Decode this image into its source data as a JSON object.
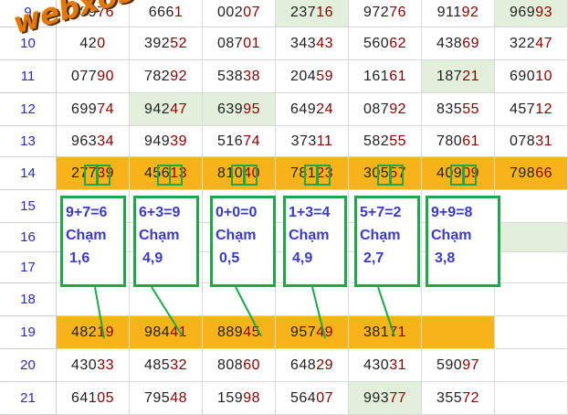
{
  "watermark": "webxoso.net",
  "rows": [
    {
      "num": "9",
      "cells": [
        [
          "689",
          "76"
        ],
        [
          "666",
          "1"
        ],
        [
          "002",
          "07"
        ],
        [
          "237",
          "16"
        ],
        [
          "972",
          "76"
        ],
        [
          "911",
          "92"
        ],
        [
          "969",
          "93"
        ]
      ],
      "green": [
        3,
        6
      ],
      "orange": false
    },
    {
      "num": "10",
      "cells": [
        [
          "42",
          "0"
        ],
        [
          "392",
          "52"
        ],
        [
          "087",
          "01"
        ],
        [
          "343",
          "43"
        ],
        [
          "560",
          "62"
        ],
        [
          "438",
          "69"
        ],
        [
          "322",
          "47"
        ]
      ],
      "green": [],
      "orange": false
    },
    {
      "num": "11",
      "cells": [
        [
          "077",
          "90"
        ],
        [
          "782",
          "92"
        ],
        [
          "538",
          "38"
        ],
        [
          "204",
          "59"
        ],
        [
          "161",
          "61"
        ],
        [
          "187",
          "21"
        ],
        [
          "690",
          "10"
        ]
      ],
      "green": [
        5
      ],
      "orange": false
    },
    {
      "num": "12",
      "cells": [
        [
          "699",
          "74"
        ],
        [
          "942",
          "47"
        ],
        [
          "639",
          "95"
        ],
        [
          "649",
          "24"
        ],
        [
          "087",
          "92"
        ],
        [
          "835",
          "55"
        ],
        [
          "457",
          "12"
        ]
      ],
      "green": [
        1,
        2
      ],
      "orange": false
    },
    {
      "num": "13",
      "cells": [
        [
          "963",
          "34"
        ],
        [
          "949",
          "39"
        ],
        [
          "516",
          "74"
        ],
        [
          "373",
          "11"
        ],
        [
          "582",
          "55"
        ],
        [
          "780",
          "61"
        ],
        [
          "078",
          "31"
        ]
      ],
      "green": [],
      "orange": false
    },
    {
      "num": "14",
      "cells": [
        [
          "277",
          "39"
        ],
        [
          "456",
          "13"
        ],
        [
          "810",
          "40"
        ],
        [
          "781",
          "23"
        ],
        [
          "305",
          "57"
        ],
        [
          "409",
          "09"
        ],
        [
          "798",
          "66"
        ]
      ],
      "green": [],
      "orange": true
    },
    {
      "num": "15",
      "cells": [],
      "green": [],
      "orange": false
    },
    {
      "num": "16",
      "cells": [],
      "green": [],
      "orange": false
    },
    {
      "num": "17",
      "cells": [],
      "green": [],
      "orange": false
    },
    {
      "num": "18",
      "cells": [],
      "green": [],
      "orange": false
    },
    {
      "num": "19",
      "cells": [
        [
          "482",
          "19"
        ],
        [
          "984",
          "41"
        ],
        [
          "889",
          "45"
        ],
        [
          "957",
          "49"
        ],
        [
          "381",
          "71"
        ],
        [
          "",
          ""
        ]
      ],
      "green": [],
      "orange": true
    },
    {
      "num": "20",
      "cells": [
        [
          "430",
          "33"
        ],
        [
          "485",
          "32"
        ],
        [
          "808",
          "60"
        ],
        [
          "648",
          "29"
        ],
        [
          "430",
          "31"
        ],
        [
          "590",
          "97"
        ]
      ],
      "green": [],
      "orange": false
    },
    {
      "num": "21",
      "cells": [
        [
          "641",
          "05"
        ],
        [
          "795",
          "48"
        ],
        [
          "159",
          "98"
        ],
        [
          "564",
          "07"
        ],
        [
          "993",
          "77"
        ],
        [
          "355",
          "72"
        ]
      ],
      "green": [
        4
      ],
      "orange": false
    }
  ],
  "boxes": [
    {
      "sum": "9+7=6",
      "label": "Chạm",
      "digits": "1,6"
    },
    {
      "sum": "6+3=9",
      "label": "Chạm",
      "digits": "4,9"
    },
    {
      "sum": "0+0=0",
      "label": "Chạm",
      "digits": "0,5"
    },
    {
      "sum": "1+3=4",
      "label": "Chạm",
      "digits": "4,9"
    },
    {
      "sum": "5+7=2",
      "label": "Chạm",
      "digits": "2,7"
    },
    {
      "sum": "9+9=8",
      "label": "Chạm",
      "digits": "3,8"
    }
  ]
}
